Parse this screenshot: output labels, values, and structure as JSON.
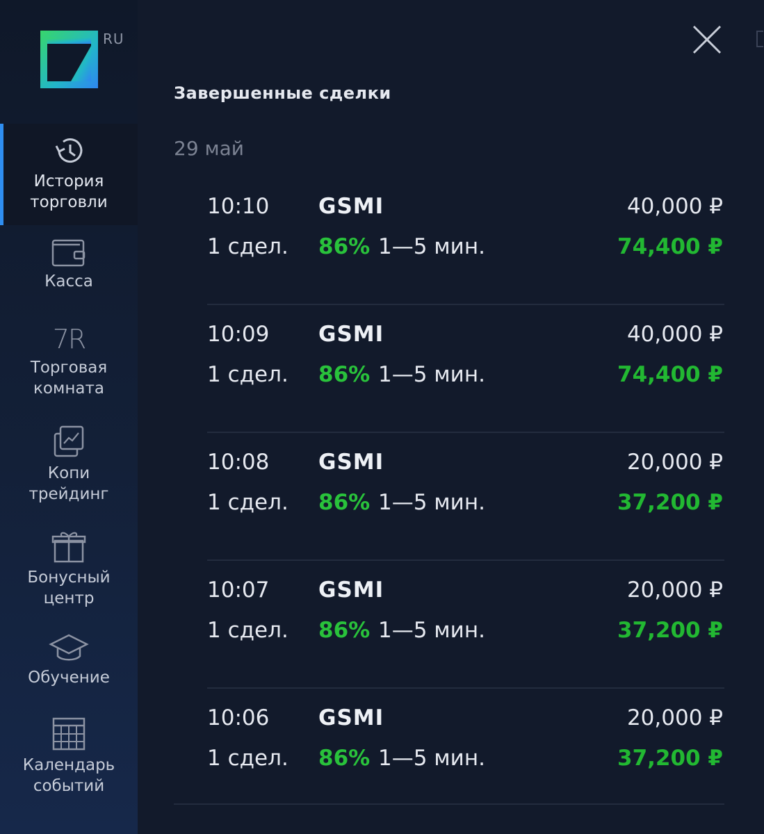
{
  "brand": {
    "logo_suffix": "RU",
    "accent": "#2fd39a"
  },
  "sidebar": {
    "items": [
      {
        "label": "История\nторговли",
        "icon": "history-icon",
        "active": true
      },
      {
        "label": "Касса",
        "icon": "wallet-icon",
        "active": false
      },
      {
        "label": "Торговая\nкомната",
        "icon": "trading-room-icon",
        "icon_text": "7R",
        "active": false
      },
      {
        "label": "Копи\nтрейдинг",
        "icon": "copy-trading-icon",
        "active": false
      },
      {
        "label": "Бонусный\nцентр",
        "icon": "gift-icon",
        "active": false
      },
      {
        "label": "Обучение",
        "icon": "graduation-cap-icon",
        "active": false
      },
      {
        "label": "Календарь\nсобытий",
        "icon": "calendar-icon",
        "active": false
      }
    ]
  },
  "panel": {
    "title": "Завершенные сделки",
    "date": "29 май",
    "close_icon": "close-icon",
    "deals": [
      {
        "time": "10:10",
        "asset": "GSMI",
        "amount": "40,000 ₽",
        "count": "1 сдел.",
        "percent": "86%",
        "duration": "1—5 мин.",
        "payout": "74,400 ₽"
      },
      {
        "time": "10:09",
        "asset": "GSMI",
        "amount": "40,000 ₽",
        "count": "1 сдел.",
        "percent": "86%",
        "duration": "1—5 мин.",
        "payout": "74,400 ₽"
      },
      {
        "time": "10:08",
        "asset": "GSMI",
        "amount": "20,000 ₽",
        "count": "1 сдел.",
        "percent": "86%",
        "duration": "1—5 мин.",
        "payout": "37,200 ₽"
      },
      {
        "time": "10:07",
        "asset": "GSMI",
        "amount": "20,000 ₽",
        "count": "1 сдел.",
        "percent": "86%",
        "duration": "1—5 мин.",
        "payout": "37,200 ₽"
      },
      {
        "time": "10:06",
        "asset": "GSMI",
        "amount": "20,000 ₽",
        "count": "1 сдел.",
        "percent": "86%",
        "duration": "1—5 мин.",
        "payout": "37,200 ₽"
      }
    ]
  },
  "colors": {
    "background": "#121a2b",
    "profit_green": "#22b832",
    "active_indicator": "#2f8ef0"
  }
}
